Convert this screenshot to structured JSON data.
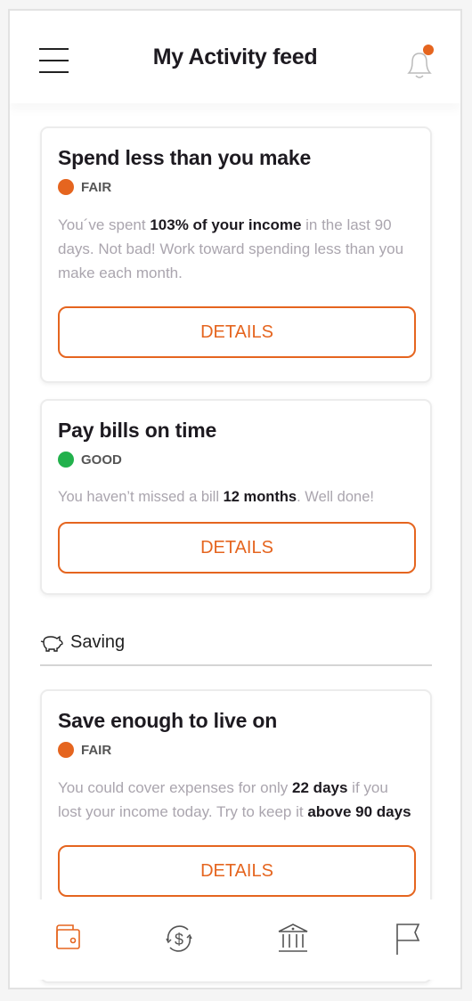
{
  "header": {
    "title": "My Activity feed",
    "notification_badge": true
  },
  "colors": {
    "accent": "#e5651f",
    "fair": "#e5651f",
    "good": "#22b14c"
  },
  "cards": [
    {
      "title": "Spend less than you make",
      "status": "FAIR",
      "status_color": "#e5651f",
      "desc": [
        "You´ve spent ",
        "103% of your income",
        " in the last 90 days. Not bad! Work toward spending less than you make each month."
      ],
      "button": "DETAILS"
    },
    {
      "title": "Pay bills on time",
      "status": "GOOD",
      "status_color": "#22b14c",
      "desc": [
        "You haven’t missed a bill ",
        "12 months",
        ". Well done!"
      ],
      "button": "DETAILS"
    },
    {
      "title": "Save enough to live on",
      "status": "FAIR",
      "status_color": "#e5651f",
      "desc": [
        "You could cover expenses for only ",
        "22 days",
        " if you lost your income today. Try to keep it ",
        "above 90 days"
      ],
      "button": "DETAILS"
    }
  ],
  "section": {
    "label": "Saving",
    "icon": "piggy-bank-icon"
  },
  "nav": [
    {
      "icon": "wallet-icon",
      "active": true
    },
    {
      "icon": "dollar-exchange-icon"
    },
    {
      "icon": "bank-icon"
    },
    {
      "icon": "flag-icon"
    }
  ]
}
